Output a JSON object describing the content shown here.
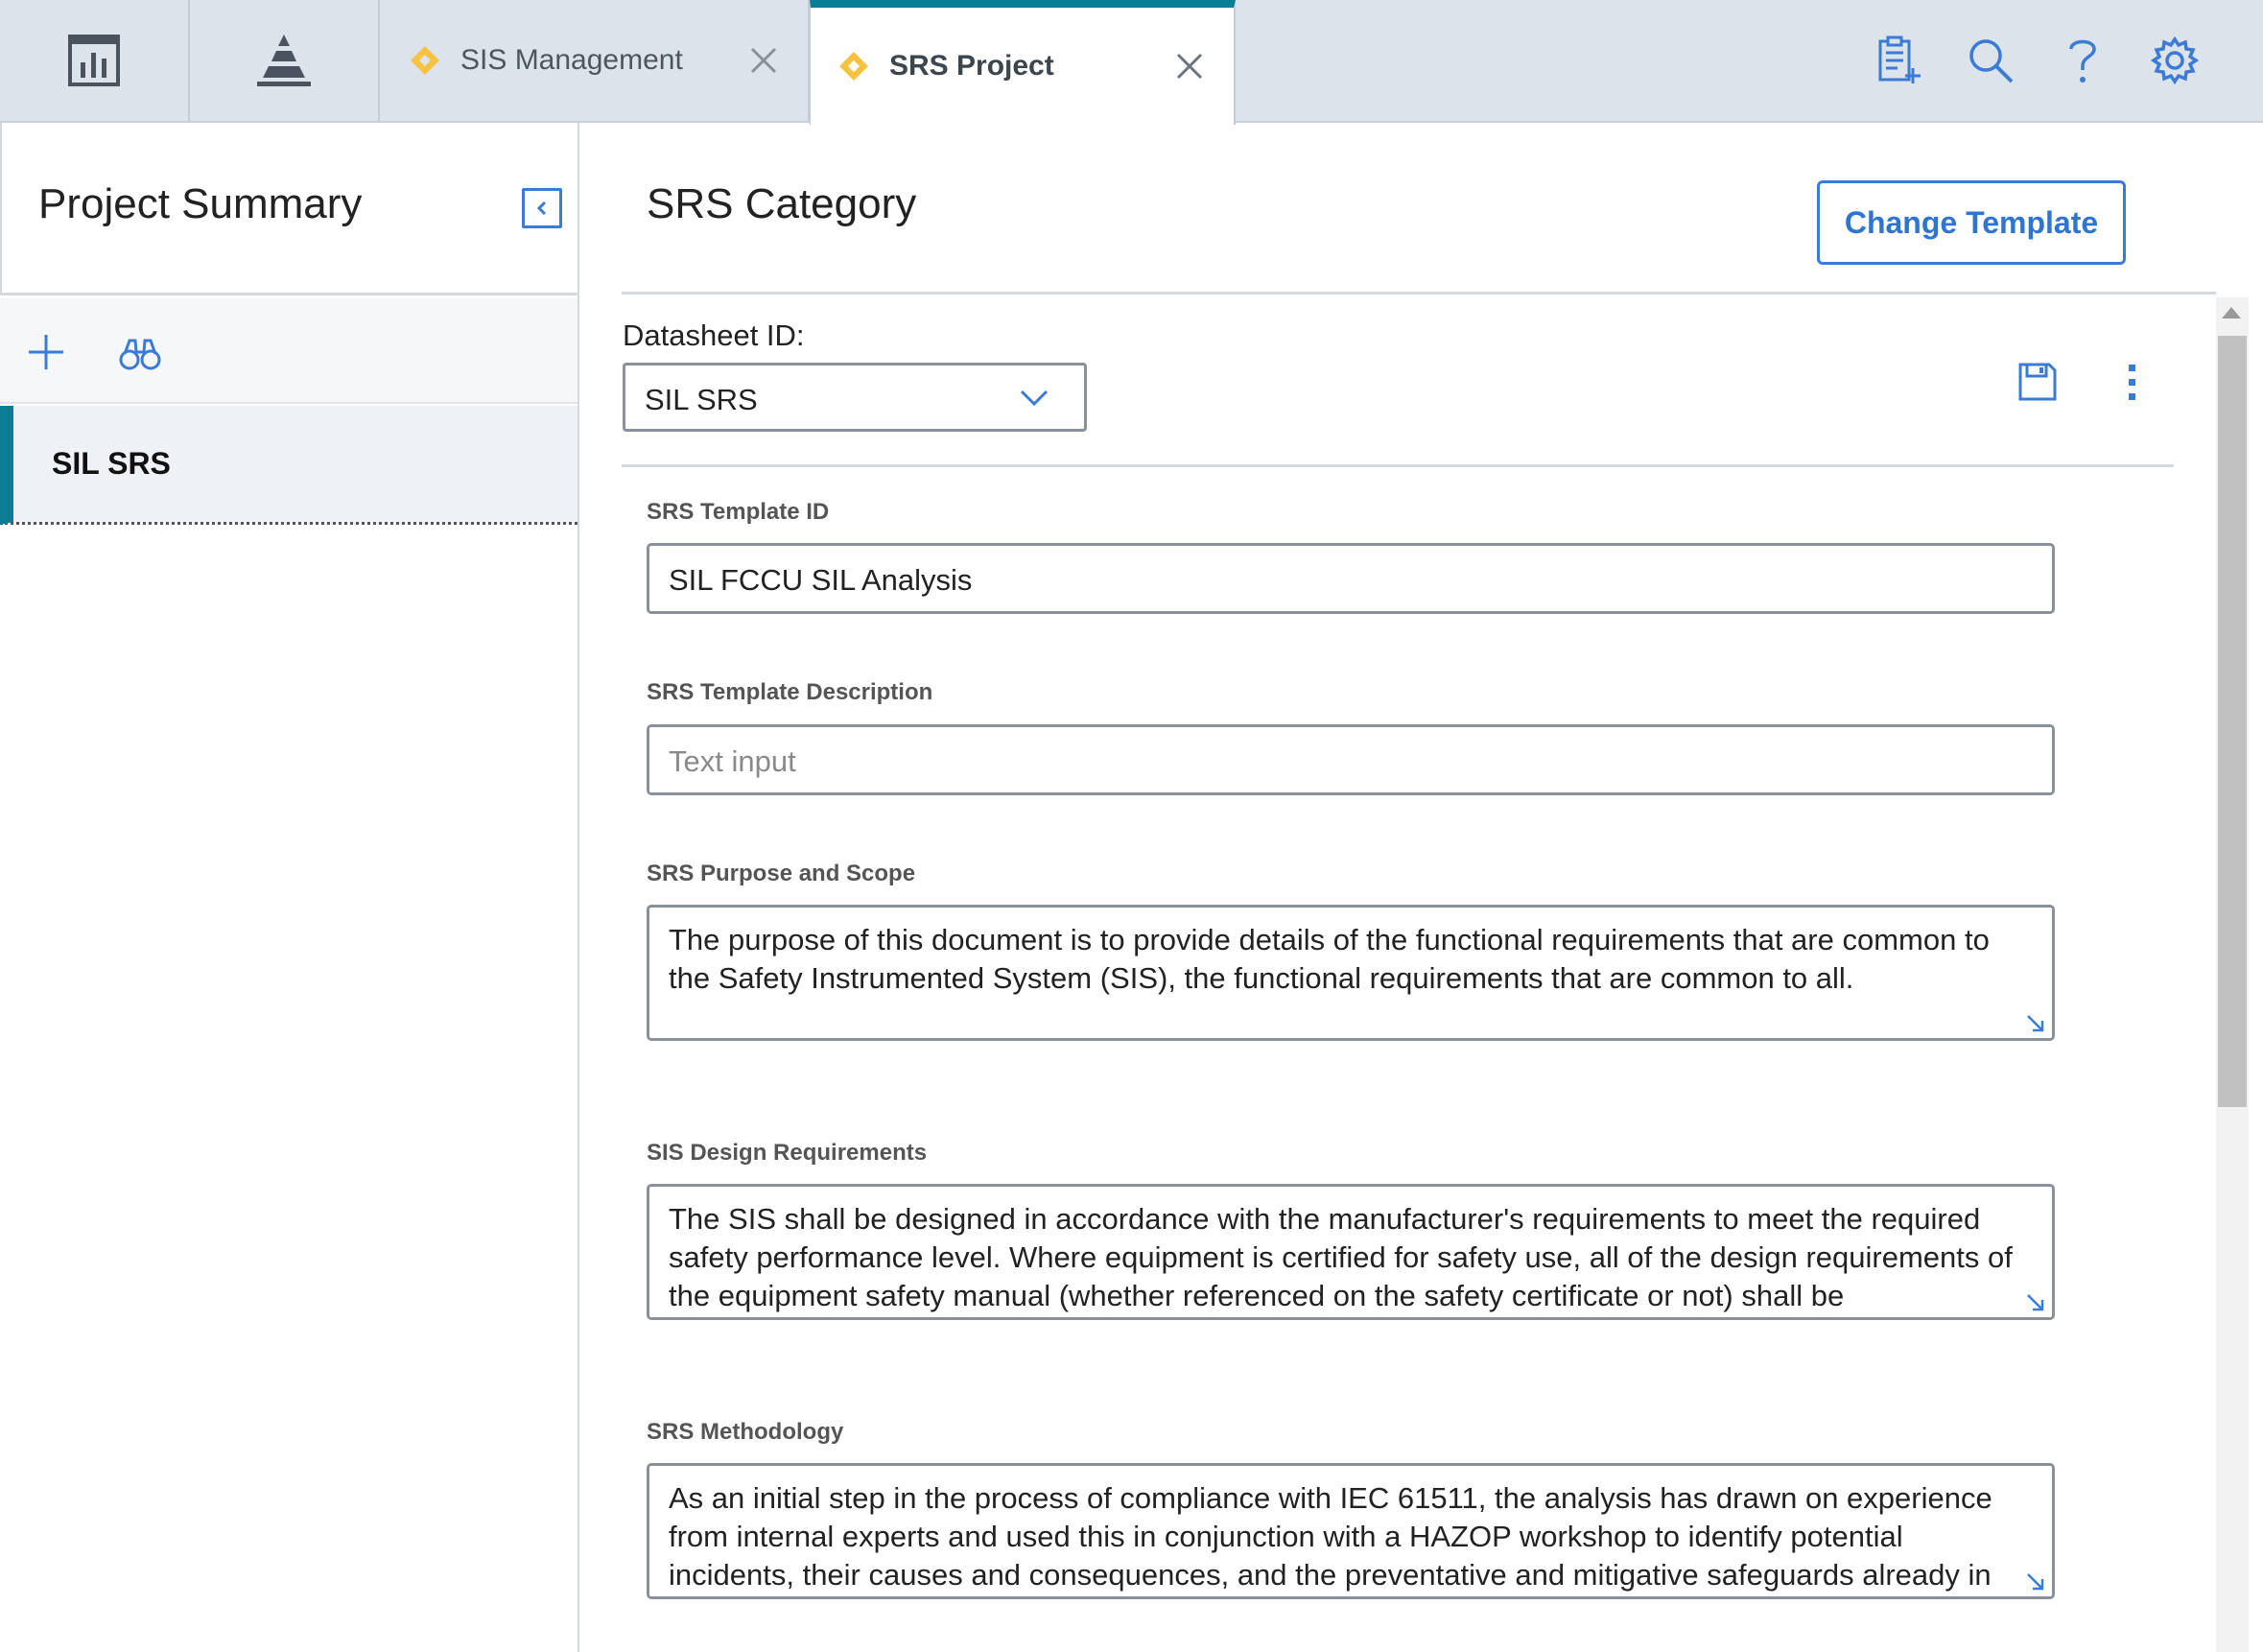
{
  "topbar": {
    "tabs": [
      {
        "label": "SIS Management"
      },
      {
        "label": "SRS Project"
      }
    ],
    "icons": [
      "dashboard-icon",
      "pyramid-icon",
      "new-report-icon",
      "search-icon",
      "help-icon",
      "settings-icon"
    ]
  },
  "left_panel": {
    "title": "Project Summary",
    "items": [
      {
        "label": "SIL SRS"
      }
    ]
  },
  "main": {
    "title": "SRS Category",
    "change_template_label": "Change Template",
    "datasheet": {
      "label": "Datasheet ID:",
      "value": "SIL SRS"
    },
    "fields": {
      "template_id": {
        "label": "SRS Template ID",
        "value": "SIL FCCU SIL Analysis"
      },
      "template_description": {
        "label": "SRS Template Description",
        "placeholder": "Text input"
      },
      "purpose_scope": {
        "label": "SRS Purpose and Scope",
        "value": "The purpose of this document is to provide details of the functional requirements that are common to the Safety Instrumented System (SIS), the functional requirements that are common to all."
      },
      "design_requirements": {
        "label": "SIS Design Requirements",
        "value": "The SIS shall be designed in accordance with the manufacturer's requirements to meet the required safety performance level. Where equipment is certified for safety use, all of the design requirements of the equipment safety manual (whether referenced on the safety certificate or not) shall be implemented."
      },
      "methodology": {
        "label": "SRS Methodology",
        "value": "As an initial step in the process of compliance with IEC 61511, the analysis has drawn on experience from internal experts and used this in conjunction with a HAZOP workshop to identify potential incidents, their causes and consequences, and the preventative and mitigative safeguards already in"
      }
    }
  },
  "colors": {
    "accent_teal": "#0b7d95",
    "accent_blue": "#2f74d0",
    "tab_diamond": "#f5c242",
    "topbar_bg": "#dde3ea"
  }
}
